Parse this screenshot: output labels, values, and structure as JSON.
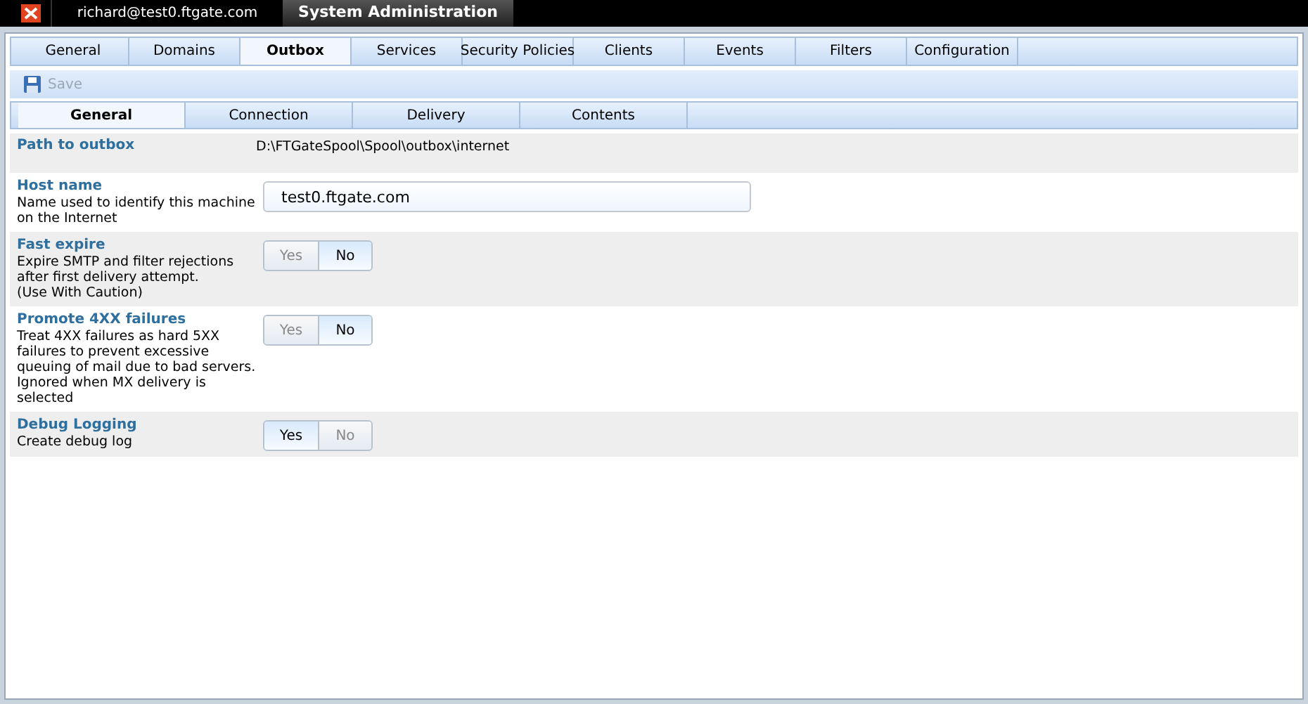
{
  "title_bar": {
    "user": "richard@test0.ftgate.com",
    "tabs": [
      {
        "label": "System Administration",
        "selected": true
      }
    ]
  },
  "tabs": [
    {
      "label": "General",
      "selected": false
    },
    {
      "label": "Domains",
      "selected": false
    },
    {
      "label": "Outbox",
      "selected": true
    },
    {
      "label": "Services",
      "selected": false
    },
    {
      "label": "Security Policies",
      "selected": false
    },
    {
      "label": "Clients",
      "selected": false
    },
    {
      "label": "Events",
      "selected": false
    },
    {
      "label": "Filters",
      "selected": false
    },
    {
      "label": "Configuration",
      "selected": false
    }
  ],
  "toolbar": {
    "save": {
      "label": "Save",
      "disabled": true
    }
  },
  "subtabs": [
    {
      "label": "General",
      "selected": true
    },
    {
      "label": "Connection",
      "selected": false
    },
    {
      "label": "Delivery",
      "selected": false
    },
    {
      "label": "Contents",
      "selected": false
    }
  ],
  "settings": [
    {
      "kind": "text",
      "title": "Path to outbox",
      "value": "D:\\FTGateSpool\\Spool\\outbox\\internet"
    },
    {
      "kind": "field",
      "title": "Host name",
      "description": "Name used to identify this machine on the Internet",
      "value": "test0.ftgate.com"
    },
    {
      "kind": "toggle",
      "title": "Fast expire",
      "description": "Expire SMTP and filter rejections after first delivery attempt.\n(Use With Caution)",
      "options": [
        {
          "label": "Yes",
          "selected": false
        },
        {
          "label": "No",
          "selected": true
        }
      ]
    },
    {
      "kind": "toggle",
      "title": "Promote 4XX failures",
      "description": "Treat 4XX failures as hard 5XX failures to prevent excessive queuing of mail due to bad servers. Ignored when MX delivery is selected",
      "options": [
        {
          "label": "Yes",
          "selected": false
        },
        {
          "label": "No",
          "selected": true
        }
      ]
    },
    {
      "kind": "toggle",
      "title": "Debug Logging",
      "description": "Create debug log",
      "options": [
        {
          "label": "Yes",
          "selected": true
        },
        {
          "label": "No",
          "selected": false
        }
      ]
    }
  ]
}
